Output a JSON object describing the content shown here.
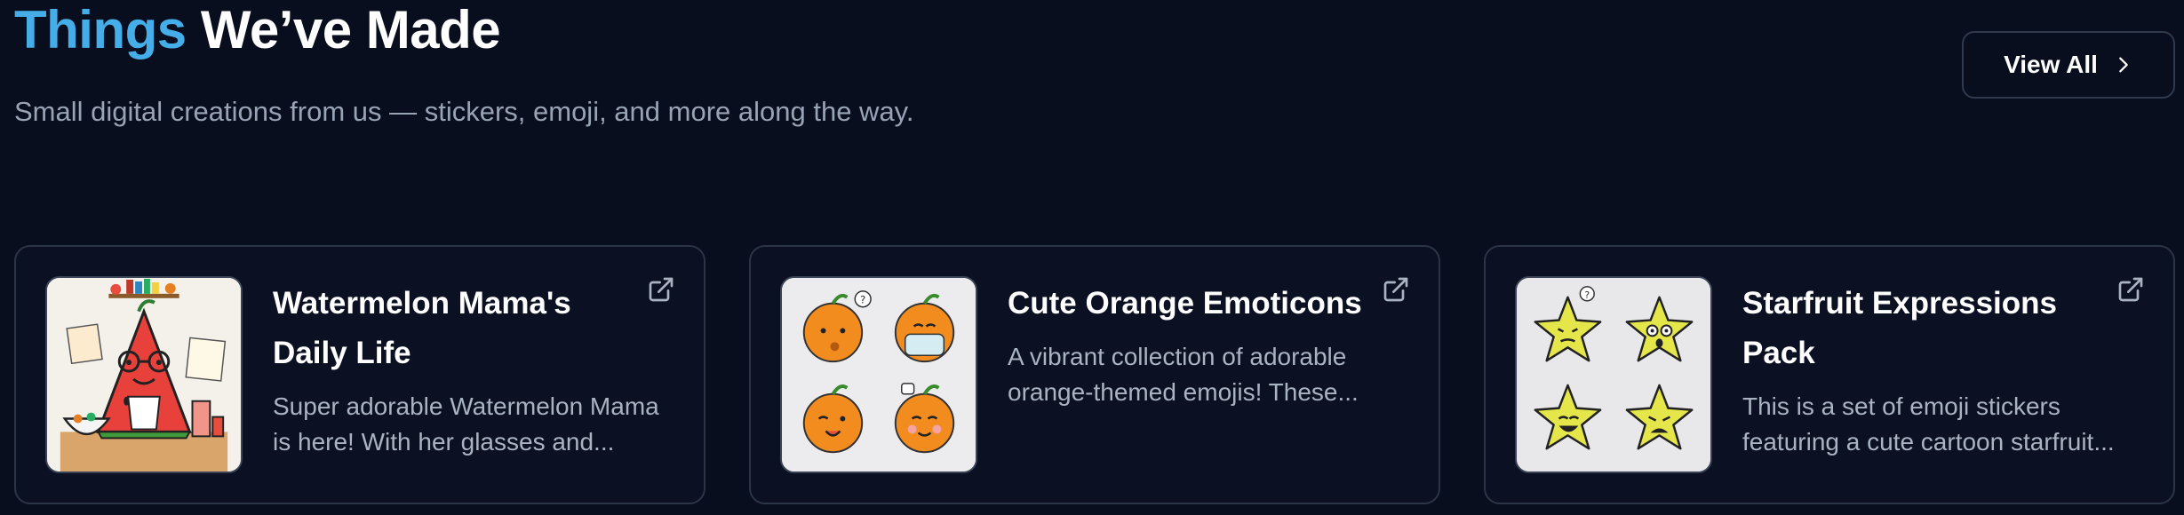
{
  "header": {
    "title_accent": "Things",
    "title_rest": "We’ve Made",
    "subtitle": "Small digital creations from us — stickers, emoji, and more along the way.",
    "view_all_label": "View All"
  },
  "colors": {
    "background": "#090e1e",
    "accent": "#45ade8",
    "card_border": "#2b3547",
    "muted_text": "#aab3c2"
  },
  "cards": [
    {
      "title": "Watermelon Mama's Daily Life",
      "description": "Super adorable Watermelon Mama is here! With her glasses and...",
      "icon": "external-link-icon"
    },
    {
      "title": "Cute Orange Emoticons",
      "description": "A vibrant collection of adorable orange-themed emojis! These...",
      "icon": "external-link-icon"
    },
    {
      "title": "Starfruit Expressions Pack",
      "description": "This is a set of emoji stickers featuring a cute cartoon starfruit...",
      "icon": "external-link-icon"
    }
  ]
}
